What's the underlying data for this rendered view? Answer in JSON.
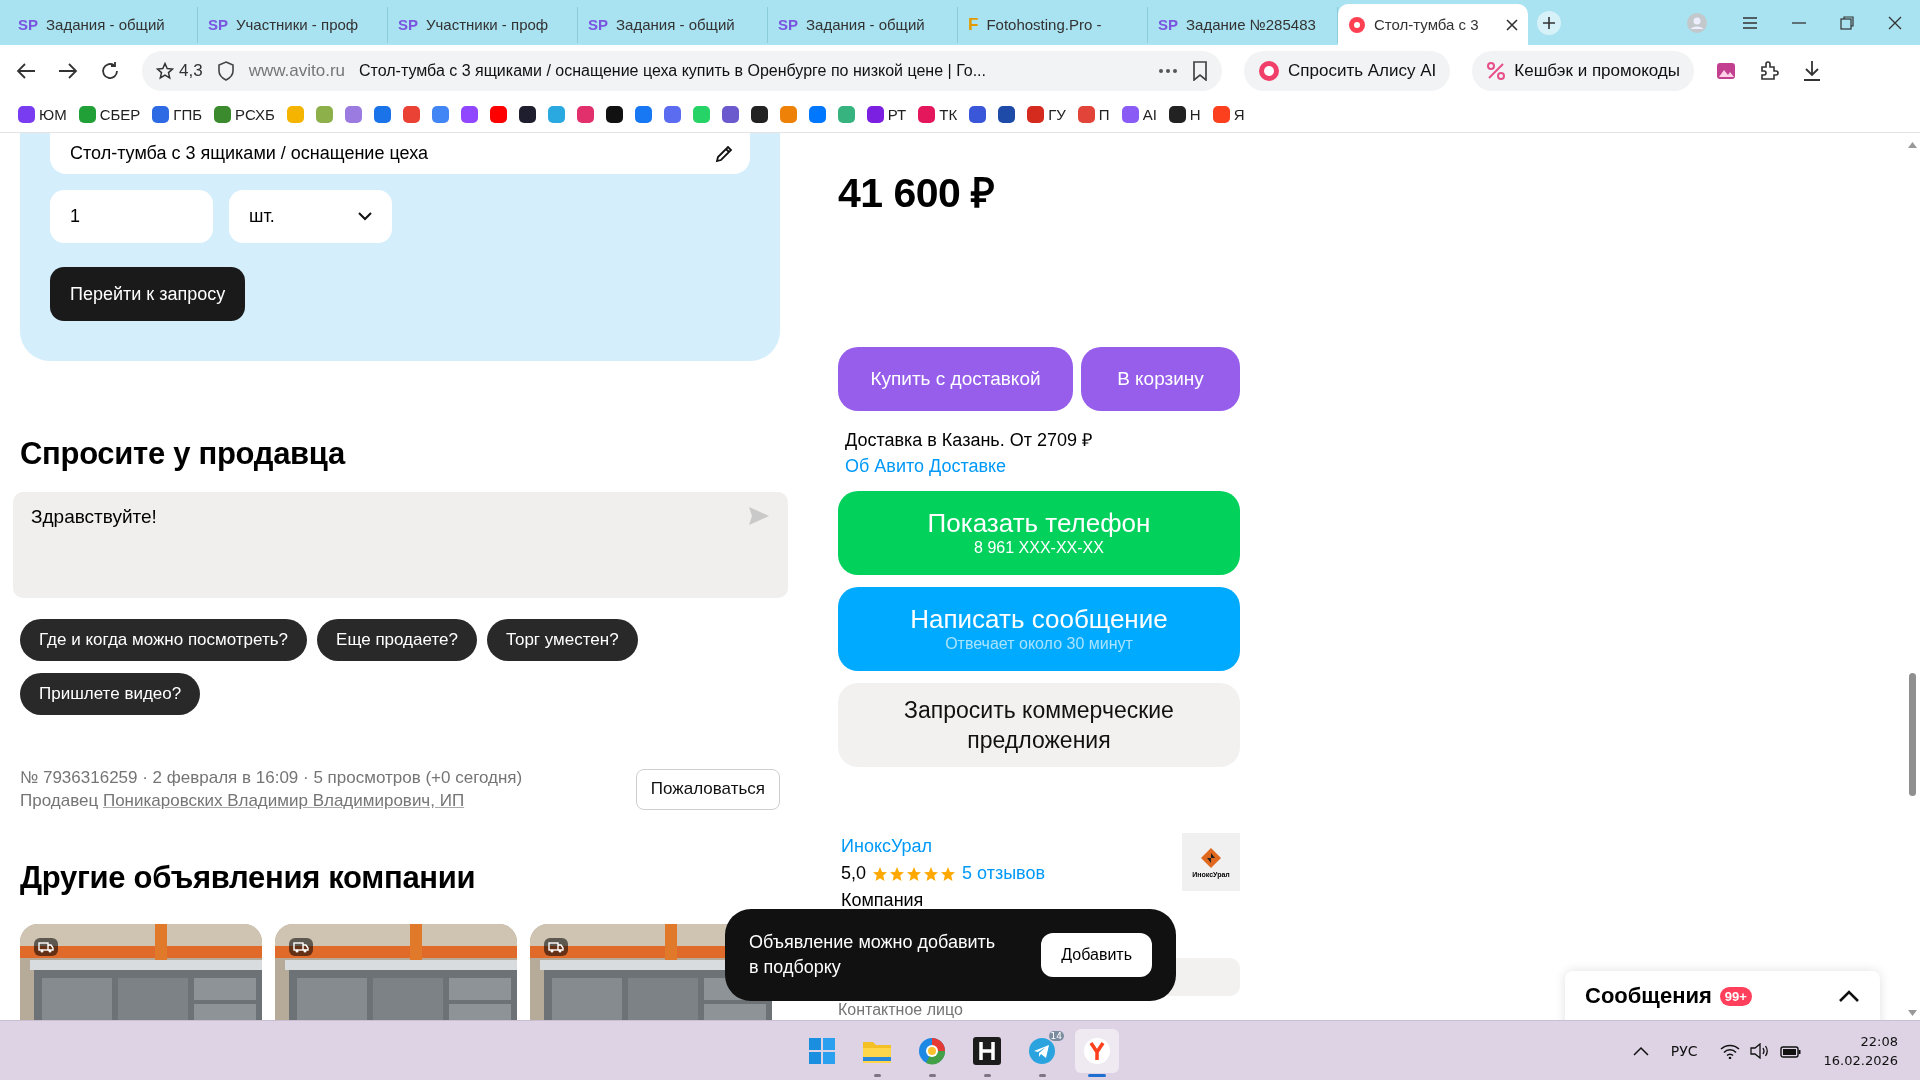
{
  "browser": {
    "tabs": [
      {
        "icon_text": "SP",
        "kind": "sp",
        "title": "Задания - общий",
        "selected": false
      },
      {
        "icon_text": "SP",
        "kind": "sp",
        "title": "Участники - проф",
        "selected": false
      },
      {
        "icon_text": "SP",
        "kind": "sp",
        "title": "Участники - проф",
        "selected": false
      },
      {
        "icon_text": "SP",
        "kind": "sp",
        "title": "Задания - общий",
        "selected": false
      },
      {
        "icon_text": "SP",
        "kind": "sp",
        "title": "Задания - общий",
        "selected": false
      },
      {
        "icon_text": "F",
        "kind": "fotohosting",
        "title": "Fotohosting.Pro -",
        "selected": false
      },
      {
        "icon_text": "SP",
        "kind": "sp",
        "title": "Задание №285483",
        "selected": false
      },
      {
        "kind": "avito",
        "title": "Стол-тумба с 3",
        "selected": true
      }
    ],
    "address": {
      "rating": "4,3",
      "domain": "www.avito.ru",
      "title": "Стол-тумба с 3 ящиками / оснащение цеха купить в Оренбурге по низкой цене | Го..."
    },
    "alice_button": "Спросить Алису AI",
    "cashback_button": "Кешбэк и промокоды",
    "bookmarks": [
      {
        "label": "ЮМ",
        "color": "#7a3cf0"
      },
      {
        "label": "СБЕР",
        "color": "#21a038"
      },
      {
        "label": "ГПБ",
        "color": "#2d6ae3"
      },
      {
        "label": "РСХБ",
        "color": "#3c8a2e"
      },
      {
        "color": "#f5b400"
      },
      {
        "color": "#8db04a"
      },
      {
        "color": "#9b7be0"
      },
      {
        "color": "#1a73e8"
      },
      {
        "color": "#ea4335"
      },
      {
        "color": "#4285f4"
      },
      {
        "color": "#9146ff"
      },
      {
        "color": "#ff0000"
      },
      {
        "color": "#1e1e2e"
      },
      {
        "color": "#2aa8e0"
      },
      {
        "color": "#e1306c"
      },
      {
        "color": "#111111"
      },
      {
        "color": "#1877f2"
      },
      {
        "color": "#5b6cf0"
      },
      {
        "color": "#25d366"
      },
      {
        "color": "#6a5acd"
      },
      {
        "color": "#222222"
      },
      {
        "color": "#ee8208"
      },
      {
        "color": "#0077ff"
      },
      {
        "color": "#36b37e"
      },
      {
        "label": "РТ",
        "color": "#7b1fe0"
      },
      {
        "label": "ТК",
        "color": "#e5175c"
      },
      {
        "color": "#3a57d9"
      },
      {
        "color": "#1e4aa8"
      },
      {
        "label": "ГУ",
        "color": "#d52b1e"
      },
      {
        "label": "П",
        "color": "#e2443a"
      },
      {
        "label": "AI",
        "color": "#8a5cf5"
      },
      {
        "label": "Н",
        "color": "#222222"
      },
      {
        "label": "Я",
        "color": "#fc3f1d"
      }
    ]
  },
  "request_card": {
    "title_value": "Стол-тумба с 3 ящиками / оснащение цеха",
    "quantity_value": "1",
    "unit": "шт.",
    "button": "Перейти к запросу"
  },
  "ask_seller": {
    "heading": "Спросите у продавца",
    "message_value": "Здравствуйте!",
    "chips": [
      "Где и когда можно посмотреть?",
      "Еще продаете?",
      "Торг уместен?",
      "Пришлете видео?"
    ]
  },
  "listing_meta": {
    "info": "№ 7936316259 · 2 февраля в 16:09 · 5 просмотров (+0 сегодня)",
    "seller_label": "Продавец",
    "seller_link": "Поникаровских Владимир Владимирович, ИП",
    "report_button": "Пожаловаться"
  },
  "other_listings": {
    "heading": "Другие объявления компании"
  },
  "sidebar": {
    "price": "41 600 ₽",
    "buy_button": "Купить с доставкой",
    "cart_button": "В корзину",
    "delivery_text": "Доставка в Казань. От 2709 ₽",
    "delivery_link": "Об Авито Доставке",
    "phone_button": {
      "label": "Показать телефон",
      "number": "8 961 XXX-XX-XX"
    },
    "message_button": {
      "label": "Написать сообщение",
      "subtitle": "Отвечает около 30 минут"
    },
    "offers_button": "Запросить коммерческие предложения",
    "seller": {
      "name": "ИноксУрал",
      "rating": "5,0",
      "stars": 5,
      "reviews_link": "5 отзывов",
      "type": "Компания",
      "logo_text": "ИноксУрал"
    },
    "contact_label": "Контактное лицо"
  },
  "toast": {
    "text": "Объявление можно добавить в подборку",
    "button": "Добавить"
  },
  "messages_widget": {
    "title": "Сообщения",
    "badge": "99+"
  },
  "taskbar": {
    "apps": [
      {
        "kind": "start",
        "running": false,
        "selected": false
      },
      {
        "kind": "explorer",
        "running": true,
        "selected": false
      },
      {
        "kind": "browser",
        "running": true,
        "selected": false
      },
      {
        "kind": "h-app",
        "running": true,
        "selected": false
      },
      {
        "kind": "telegram",
        "running": true,
        "selected": false,
        "badge": "14"
      },
      {
        "kind": "yandex",
        "running": true,
        "selected": true
      }
    ],
    "language": "РУС",
    "time": "22:08",
    "date": "16.02.2026"
  }
}
